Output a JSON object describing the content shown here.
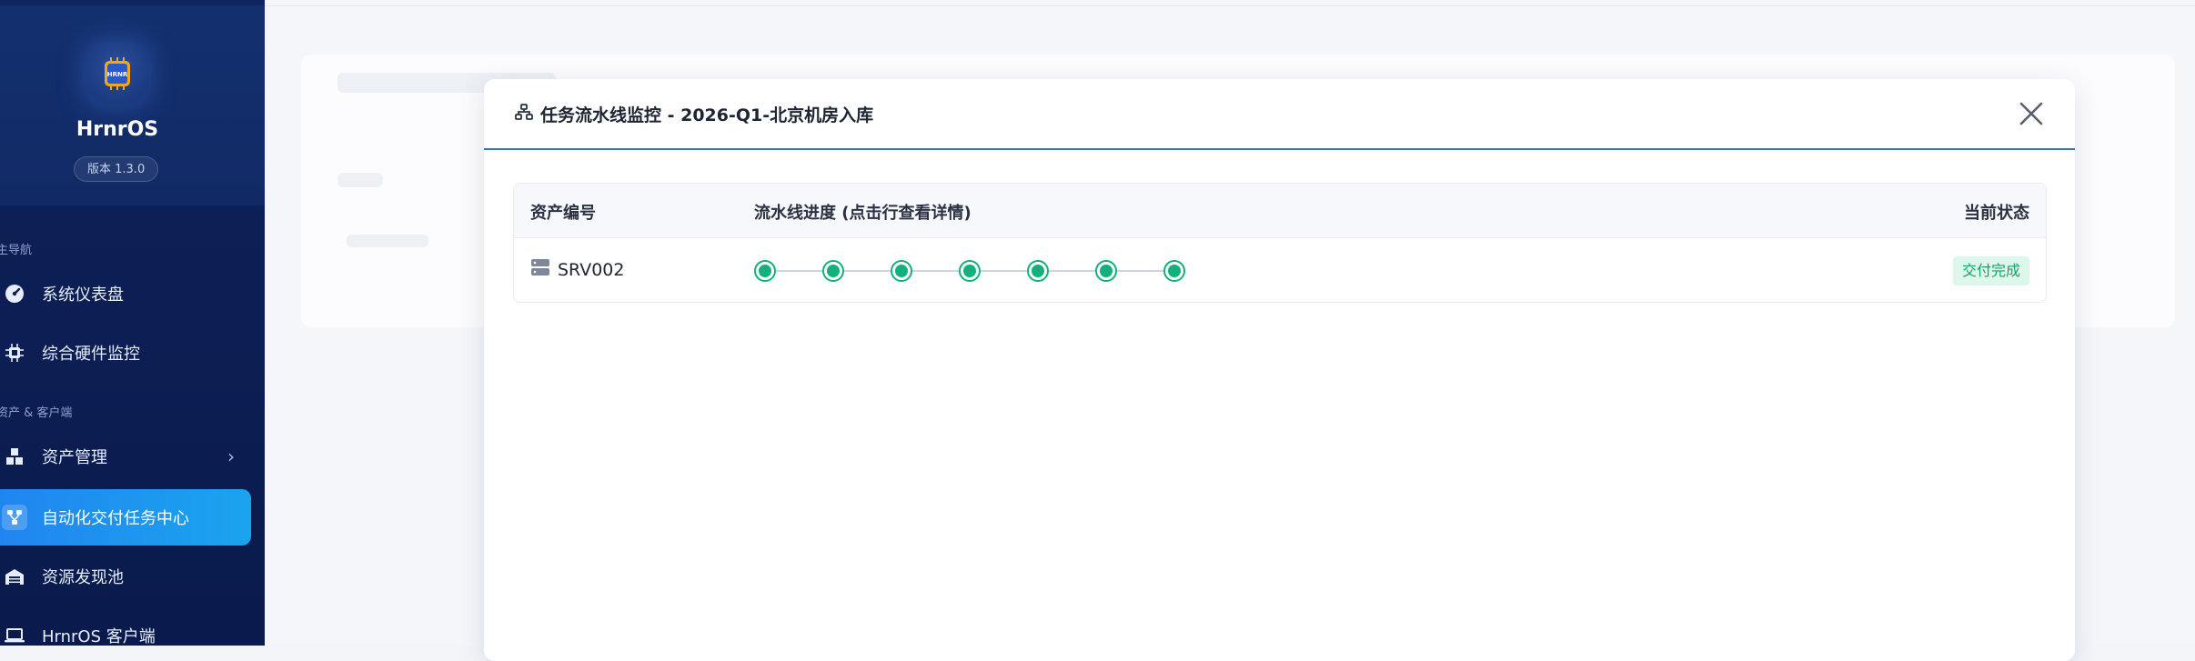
{
  "sidebar": {
    "brand_name": "HrnrOS",
    "logo_text": "HRNR",
    "version": "版本 1.3.0",
    "sections": {
      "main_nav": "主导航",
      "asset_client": "资产 & 客户端"
    },
    "items": [
      {
        "label": "系统仪表盘",
        "icon": "dashboard-icon"
      },
      {
        "label": "综合硬件监控",
        "icon": "chip-icon"
      },
      {
        "label": "资产管理",
        "icon": "boxes-icon"
      },
      {
        "label": "自动化交付任务中心",
        "icon": "workflow-icon"
      },
      {
        "label": "资源发现池",
        "icon": "warehouse-icon"
      },
      {
        "label": "HrnrOS 客户端",
        "icon": "laptop-icon"
      }
    ],
    "colors": {
      "active_start": "#2185f0",
      "active_end": "#1aa4ee",
      "bg": "#0c1f55"
    }
  },
  "modal": {
    "title": "任务流水线监控 - 2026-Q1-北京机房入库",
    "title_icon": "sitemap-icon",
    "close_icon": "close-icon",
    "accent": "#2f6fe0",
    "table": {
      "columns": {
        "asset_id": "资产编号",
        "pipeline": "流水线进度 (点击行查看详情)",
        "status": "当前状态"
      },
      "rows": [
        {
          "asset_id": "SRV002",
          "asset_icon": "server-icon",
          "steps_total": 7,
          "steps_completed": 7,
          "status": "交付完成",
          "status_color": "#12a46e"
        }
      ]
    }
  }
}
